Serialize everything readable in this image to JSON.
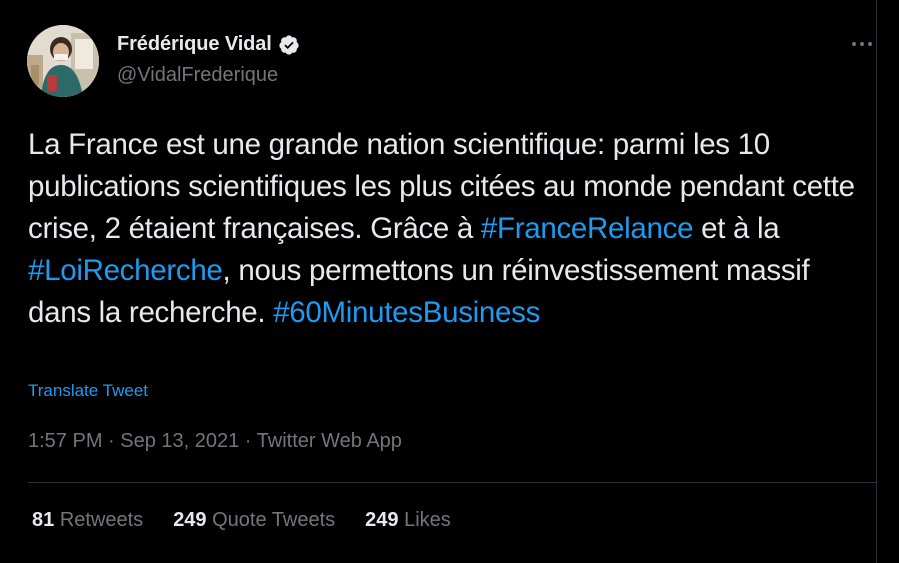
{
  "author": {
    "name": "Frédérique Vidal",
    "handle": "@VidalFrederique",
    "verified": true
  },
  "tweet": {
    "segments": [
      {
        "text": "La France est une grande nation scientifique: parmi les 10 publications scientifiques les plus citées au monde pendant cette crise, 2 étaient françaises. Grâce à ",
        "type": "text"
      },
      {
        "text": "#FranceRelance",
        "type": "hashtag"
      },
      {
        "text": " et à la ",
        "type": "text"
      },
      {
        "text": "#LoiRecherche",
        "type": "hashtag"
      },
      {
        "text": ", nous permettons un réinvestissement massif dans la recherche. ",
        "type": "text"
      },
      {
        "text": "#60MinutesBusiness",
        "type": "hashtag"
      }
    ],
    "translate_label": "Translate Tweet",
    "timestamp": "1:57 PM · Sep 13, 2021 · Twitter Web App"
  },
  "stats": {
    "retweets_count": "81",
    "retweets_label": "Retweets",
    "quotes_count": "249",
    "quotes_label": "Quote Tweets",
    "likes_count": "249",
    "likes_label": "Likes"
  },
  "colors": {
    "background": "#000000",
    "text": "#e7e9ea",
    "secondary": "#71767b",
    "accent": "#1d9bf0",
    "divider": "#2f3336"
  },
  "icons": {
    "verified": "verified-badge-icon",
    "more": "more-options-icon"
  }
}
